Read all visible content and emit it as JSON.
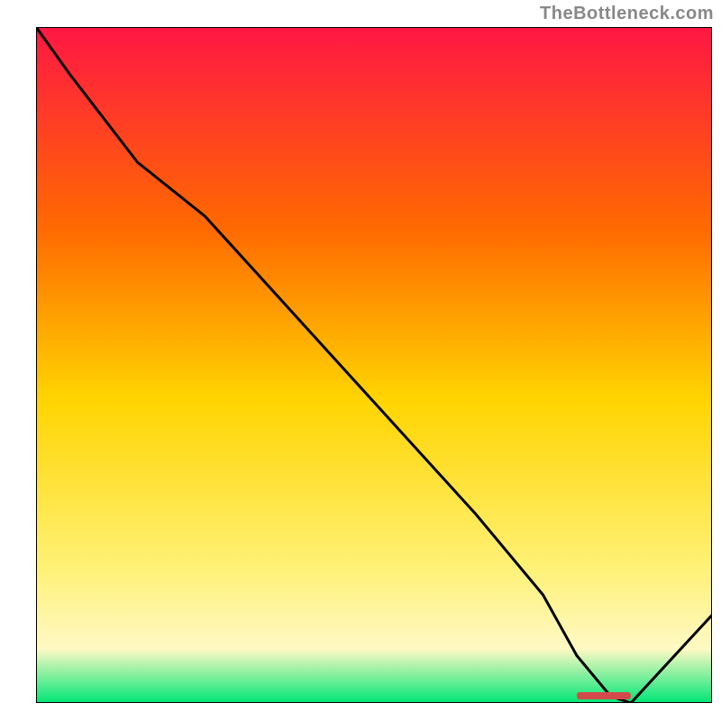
{
  "attribution": "TheBottleneck.com",
  "chart_data": {
    "type": "line",
    "title": "",
    "xlabel": "",
    "ylabel": "",
    "ylim": [
      0,
      100
    ],
    "xlim": [
      0,
      100
    ],
    "x": [
      0,
      5,
      15,
      25,
      35,
      45,
      55,
      65,
      75,
      80,
      85,
      88,
      100
    ],
    "values": [
      100,
      93,
      80,
      72,
      61,
      50,
      39,
      28,
      16,
      7,
      1,
      0,
      13
    ],
    "optimum_range_x": [
      80,
      88
    ],
    "marker_label": ""
  },
  "colors": {
    "gradient_top": "#ff1744",
    "gradient_mid1": "#ff6a00",
    "gradient_mid2": "#ffd400",
    "gradient_mid3": "#fff176",
    "gradient_mid4": "#fff9c4",
    "gradient_bottom": "#00e676",
    "border": "#000000",
    "curve": "#000000",
    "marker": "#d44a4a"
  }
}
